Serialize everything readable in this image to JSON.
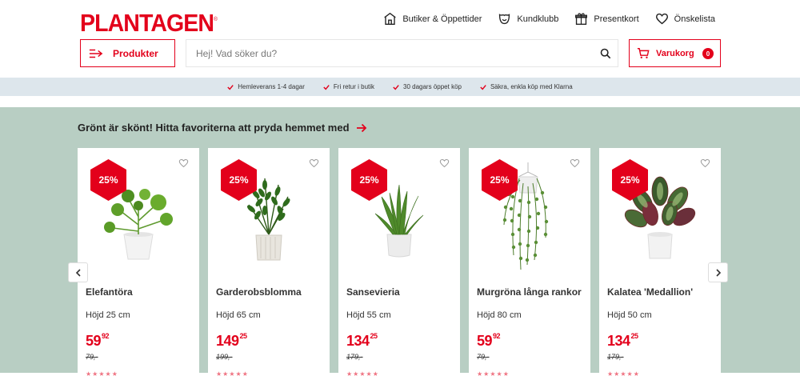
{
  "brand": {
    "logo_text": "PLANTAGEN",
    "registered": "®",
    "accent": "#e3001b"
  },
  "topnav": [
    {
      "label": "Butiker & Öppettider",
      "icon": "store-icon"
    },
    {
      "label": "Kundklubb",
      "icon": "club-icon"
    },
    {
      "label": "Presentkort",
      "icon": "gift-icon"
    },
    {
      "label": "Önskelista",
      "icon": "heart-icon"
    }
  ],
  "products_button": {
    "label": "Produkter"
  },
  "search": {
    "placeholder": "Hej! Vad söker du?"
  },
  "cart": {
    "label": "Varukorg",
    "count": "0"
  },
  "usps": [
    "Hemleverans 1-4 dagar",
    "Fri retur i butik",
    "30 dagars öppet köp",
    "Säkra, enkla köp med Klarna"
  ],
  "section": {
    "title": "Grönt är skönt! Hitta favoriterna att pryda hemmet med",
    "background": "#b8cec3"
  },
  "products": [
    {
      "name": "Elefantöra",
      "height": "Höjd 25 cm",
      "price_main": "59",
      "price_dec": "92",
      "old_price": "79,-",
      "discount": "25%",
      "plant": "pilea"
    },
    {
      "name": "Garderobsblomma",
      "height": "Höjd 65 cm",
      "price_main": "149",
      "price_dec": "25",
      "old_price": "199,-",
      "discount": "25%",
      "plant": "zz"
    },
    {
      "name": "Sansevieria",
      "height": "Höjd 55 cm",
      "price_main": "134",
      "price_dec": "25",
      "old_price": "179,-",
      "discount": "25%",
      "plant": "snake"
    },
    {
      "name": "Murgröna långa rankor",
      "height": "Höjd 80 cm",
      "price_main": "59",
      "price_dec": "92",
      "old_price": "79,-",
      "discount": "25%",
      "plant": "ivy"
    },
    {
      "name": "Kalatea 'Medallion'",
      "height": "Höjd 50 cm",
      "price_main": "134",
      "price_dec": "25",
      "old_price": "179,-",
      "discount": "25%",
      "plant": "calathea"
    }
  ]
}
